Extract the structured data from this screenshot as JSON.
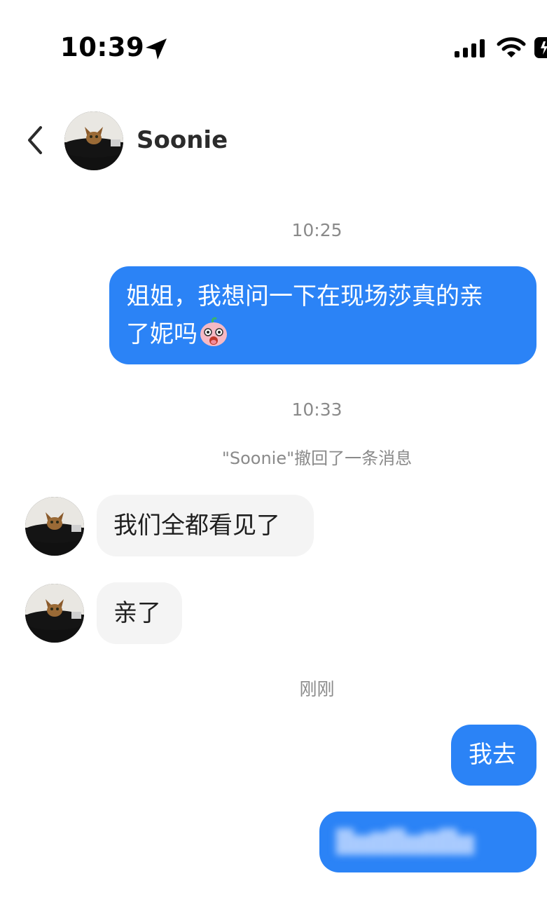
{
  "status_bar": {
    "time": "10:39",
    "icons": [
      "location-arrow-icon",
      "cellular-signal-icon",
      "wifi-icon",
      "battery-icon"
    ]
  },
  "header": {
    "back_icon": "chevron-left-icon",
    "contact_name": "Soonie"
  },
  "conversation": {
    "timestamps": [
      "10:25",
      "10:33",
      "刚刚"
    ],
    "recall_notice": "\"Soonie\"撤回了一条消息",
    "messages": [
      {
        "direction": "outgoing",
        "lines": [
          "姐姐，我想问一下在现场莎真的亲",
          "了妮吗"
        ],
        "emoji": "shocked-face-emoji"
      },
      {
        "direction": "incoming",
        "text": "我们全都看见了"
      },
      {
        "direction": "incoming",
        "text": "亲了"
      },
      {
        "direction": "outgoing",
        "text": "我去"
      },
      {
        "direction": "outgoing",
        "text": "",
        "blurred": true
      }
    ]
  },
  "colors": {
    "outgoing_bubble": "#2b83f6",
    "incoming_bubble": "#f4f4f4",
    "timestamp_text": "#8a8a8a"
  }
}
